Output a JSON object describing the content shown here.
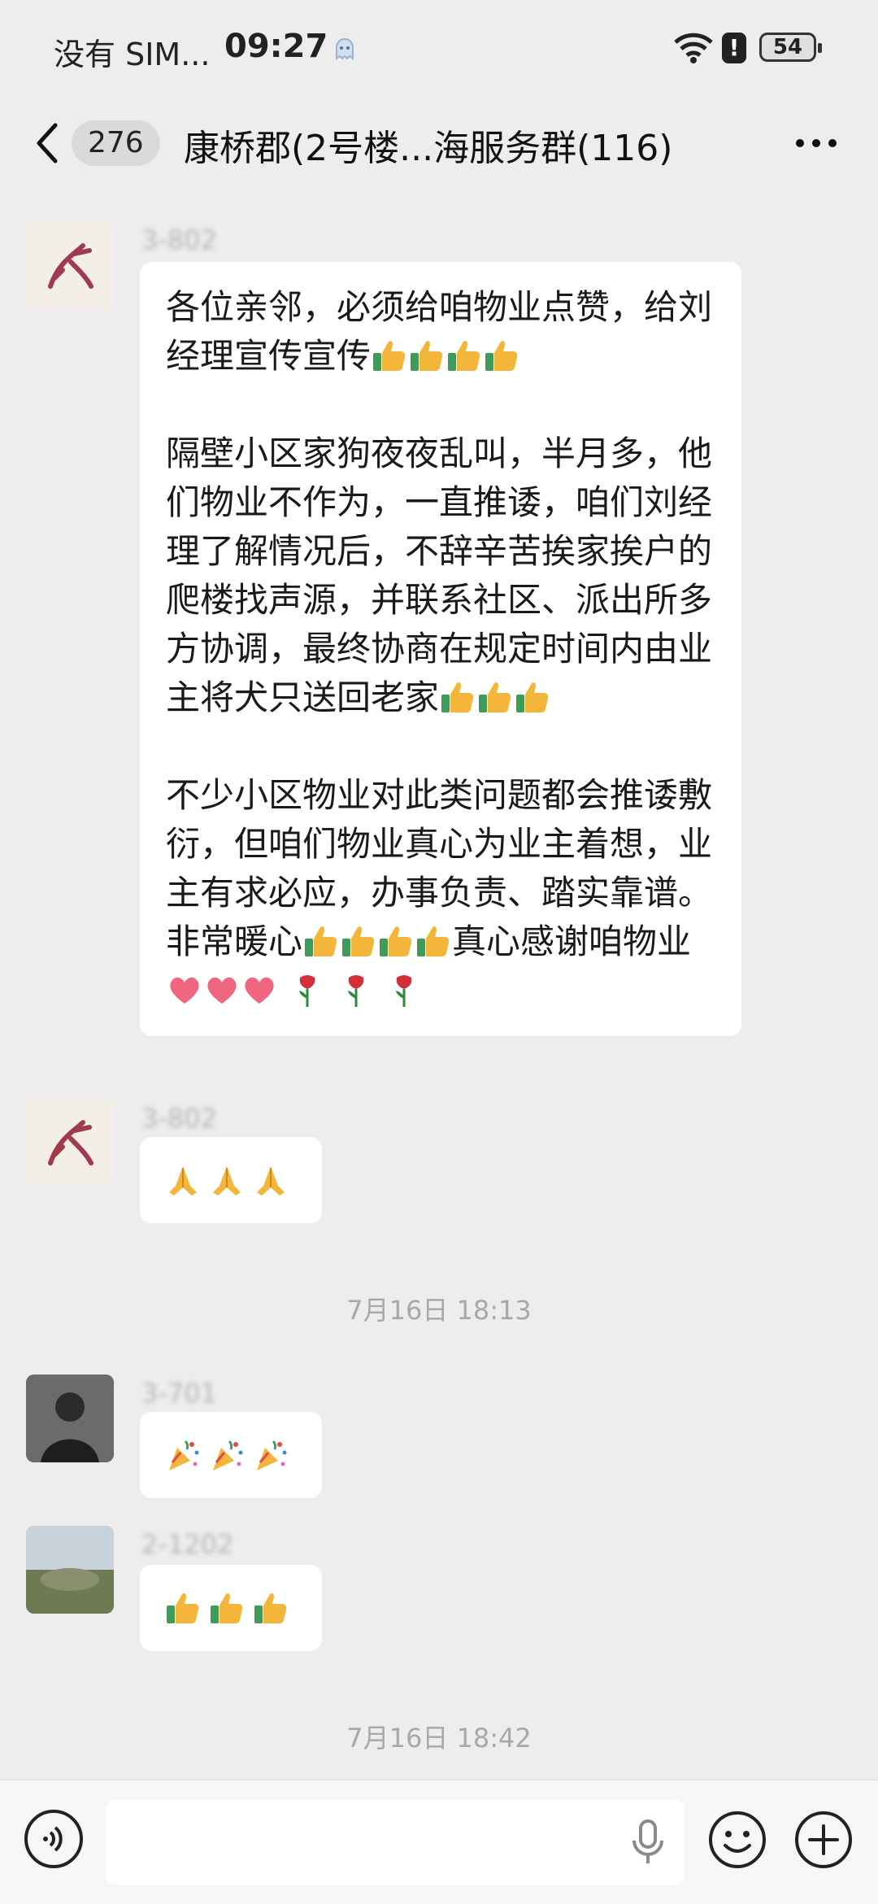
{
  "status_bar": {
    "carrier": "没有 SIM...",
    "time": "09:27",
    "battery": "54",
    "alert": "!"
  },
  "header": {
    "unread_count": "276",
    "title": "康桥郡(2号楼...海服务群(116)"
  },
  "messages": [
    {
      "sender": "3-802",
      "paragraphs": [
        "各位亲邻，必须给咱物业点赞，给刘经理宣传宣传",
        "隔壁小区家狗夜夜乱叫，半月多，他们物业不作为，一直推诿，咱们刘经理了解情况后，不辞辛苦挨家挨户的爬楼找声源，并联系社区、派出所多方协调，最终协商在规定时间内由业主将犬只送回老家",
        "不少小区物业对此类问题都会推诿敷衍，但咱们物业真心为业主着想，业主有求必应，办事负责、踏实靠谱。非常暖心",
        "真心感谢咱物业"
      ]
    },
    {
      "sender": "3-802",
      "emoji": "pray-hands"
    },
    {
      "sender": "3-701",
      "emoji": "party-popper"
    },
    {
      "sender": "2-1202",
      "emoji": "thumbs-up"
    }
  ],
  "timestamps": [
    "7月16日 18:13",
    "7月16日 18:42"
  ],
  "input": {
    "placeholder": ""
  },
  "colors": {
    "background": "#ededed",
    "bubble": "#ffffff",
    "thumb": "#f4b63a",
    "heart": "#f06680",
    "rose": "#d22f3a"
  }
}
